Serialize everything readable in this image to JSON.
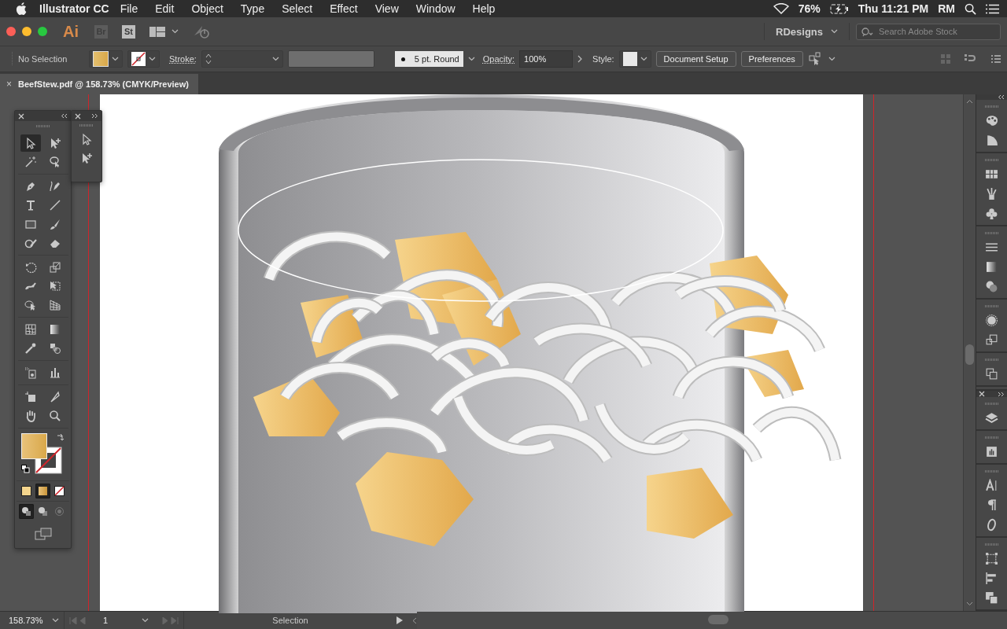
{
  "menubar": {
    "app_name": "Illustrator CC",
    "menus": [
      "File",
      "Edit",
      "Object",
      "Type",
      "Select",
      "Effect",
      "View",
      "Window",
      "Help"
    ],
    "battery": "76%",
    "clock": "Thu 11:21 PM",
    "user": "RM"
  },
  "appbar": {
    "logo": "Ai",
    "bridge": "Br",
    "stock": "St",
    "workspace": "RDesigns",
    "search": {
      "placeholder": "Search Adobe Stock"
    }
  },
  "control_bar": {
    "selection": "No Selection",
    "stroke_label": "Stroke:",
    "brush": "5 pt. Round",
    "opacity_label": "Opacity:",
    "opacity": "100%",
    "style_label": "Style:",
    "buttons": [
      "Document Setup",
      "Preferences"
    ]
  },
  "document_tab": {
    "close": "×",
    "title": "BeefStew.pdf @ 158.73% (CMYK/Preview)"
  },
  "tools": [
    [
      {
        "kind": "selection",
        "selected": true
      },
      {
        "kind": "direct-selection",
        "selected": false
      },
      {
        "kind": "magic-wand",
        "selected": false
      },
      {
        "kind": "lasso",
        "selected": false
      }
    ],
    [
      {
        "kind": "pen",
        "selected": false
      },
      {
        "kind": "curvature",
        "selected": false
      },
      {
        "kind": "type",
        "selected": false
      },
      {
        "kind": "line",
        "selected": false
      },
      {
        "kind": "rectangle",
        "selected": false
      },
      {
        "kind": "paintbrush",
        "selected": false
      },
      {
        "kind": "shaper",
        "selected": false
      },
      {
        "kind": "eraser",
        "selected": false
      }
    ],
    [
      {
        "kind": "rotate",
        "selected": false
      },
      {
        "kind": "scale",
        "selected": false
      },
      {
        "kind": "puppet",
        "selected": false
      },
      {
        "kind": "free-transform",
        "selected": false
      },
      {
        "kind": "shape-builder",
        "selected": false
      },
      {
        "kind": "perspective",
        "selected": false
      }
    ],
    [
      {
        "kind": "mesh",
        "selected": false
      },
      {
        "kind": "gradient",
        "selected": false
      },
      {
        "kind": "eyedropper",
        "selected": false
      },
      {
        "kind": "blend",
        "selected": false
      }
    ],
    [
      {
        "kind": "sprayer",
        "selected": false
      },
      {
        "kind": "graph",
        "selected": false
      }
    ],
    [
      {
        "kind": "artboard",
        "selected": false
      },
      {
        "kind": "slice",
        "selected": false
      },
      {
        "kind": "hand",
        "selected": false
      },
      {
        "kind": "zoom",
        "selected": false
      }
    ]
  ],
  "color_modes": [
    {
      "kind": "color",
      "selected": false
    },
    {
      "kind": "gradient",
      "selected": true
    },
    {
      "kind": "none",
      "selected": false
    }
  ],
  "draw_modes": [
    {
      "kind": "normal",
      "selected": true,
      "disabled": false
    },
    {
      "kind": "behind",
      "selected": false,
      "disabled": false
    },
    {
      "kind": "inside",
      "selected": false,
      "disabled": true
    }
  ],
  "flyout_tools": [
    {
      "kind": "selection"
    },
    {
      "kind": "direct-selection"
    }
  ],
  "dock": [
    [
      {
        "kind": "palette"
      },
      {
        "kind": "wedge"
      }
    ],
    [
      {
        "kind": "swatches"
      },
      {
        "kind": "brushes"
      },
      {
        "kind": "club"
      }
    ],
    [
      {
        "kind": "stroke"
      },
      {
        "kind": "gradient"
      },
      {
        "kind": "circles"
      }
    ],
    [
      {
        "kind": "dotted-circle"
      },
      {
        "kind": "squares"
      }
    ],
    [
      {
        "kind": "artboards"
      }
    ]
  ],
  "dock2": [
    [
      {
        "kind": "layers"
      }
    ],
    [
      {
        "kind": "export"
      }
    ],
    [
      {
        "kind": "character"
      },
      {
        "kind": "paragraph"
      },
      {
        "kind": "opentype"
      }
    ],
    [
      {
        "kind": "transform"
      },
      {
        "kind": "align"
      },
      {
        "kind": "pathfinder"
      }
    ]
  ],
  "status_bar": {
    "zoom": "158.73%",
    "artboard": "1",
    "tool": "Selection"
  }
}
